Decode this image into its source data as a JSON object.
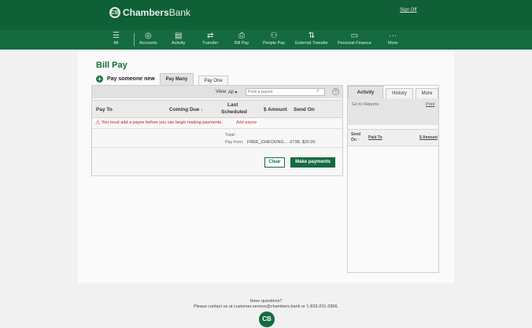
{
  "header": {
    "brand_mark": "CB",
    "brand_name": "Chambers",
    "brand_suffix": "Bank",
    "sign_off": "Sign Off"
  },
  "nav": {
    "items": [
      {
        "label": "All",
        "icon": "hamburger-icon",
        "glyph": "☰"
      },
      {
        "label": "Accounts",
        "icon": "accounts-icon",
        "glyph": "◎"
      },
      {
        "label": "Activity",
        "icon": "activity-icon",
        "glyph": "▤"
      },
      {
        "label": "Transfer",
        "icon": "transfer-icon",
        "glyph": "⇄"
      },
      {
        "label": "Bill Pay",
        "icon": "bill-pay-icon",
        "glyph": "⎙"
      },
      {
        "label": "People Pay",
        "icon": "people-pay-icon",
        "glyph": "⚇"
      },
      {
        "label": "External Transfer",
        "icon": "external-transfer-icon",
        "glyph": "⇅"
      },
      {
        "label": "Personal Finance",
        "icon": "personal-finance-icon",
        "glyph": "▭"
      },
      {
        "label": "More",
        "icon": "more-icon",
        "glyph": "···"
      }
    ]
  },
  "page": {
    "title": "Bill Pay",
    "pay_someone_new": "Pay someone new",
    "tabs": [
      "Pay Many",
      "Pay One"
    ]
  },
  "main": {
    "view_label": "View:",
    "view_value": "All ▾",
    "search_placeholder": "Find a payee",
    "columns": {
      "pay_to": "Pay To",
      "coming_due": "Coming Due ↓",
      "last_scheduled_1": "Last",
      "last_scheduled_2": "Scheduled",
      "amount": "$ Amount",
      "send_on": "Send On"
    },
    "warning": "You must add a payee before you can begin making payments.",
    "add_payee": "Add payee",
    "total_label": "Total:",
    "pay_from_label": "Pay from:",
    "pay_from_value": "FREE_CHECKING... .0738, $20.00",
    "clear": "Clear",
    "make_payments": "Make payments"
  },
  "side": {
    "tabs": [
      "Activity",
      "History",
      "More"
    ],
    "go_to_reports": "Go to Reports",
    "print": "Print",
    "cols": {
      "send_on_1": "Send",
      "send_on_2": "On ↑",
      "paid_to": "Paid To",
      "amount": "$ Amount"
    }
  },
  "footer": {
    "question": "Have questions?",
    "contact": "Please contact us at customer.service@chambers.bank or 1-833-201-2966.",
    "logo": "CB"
  }
}
